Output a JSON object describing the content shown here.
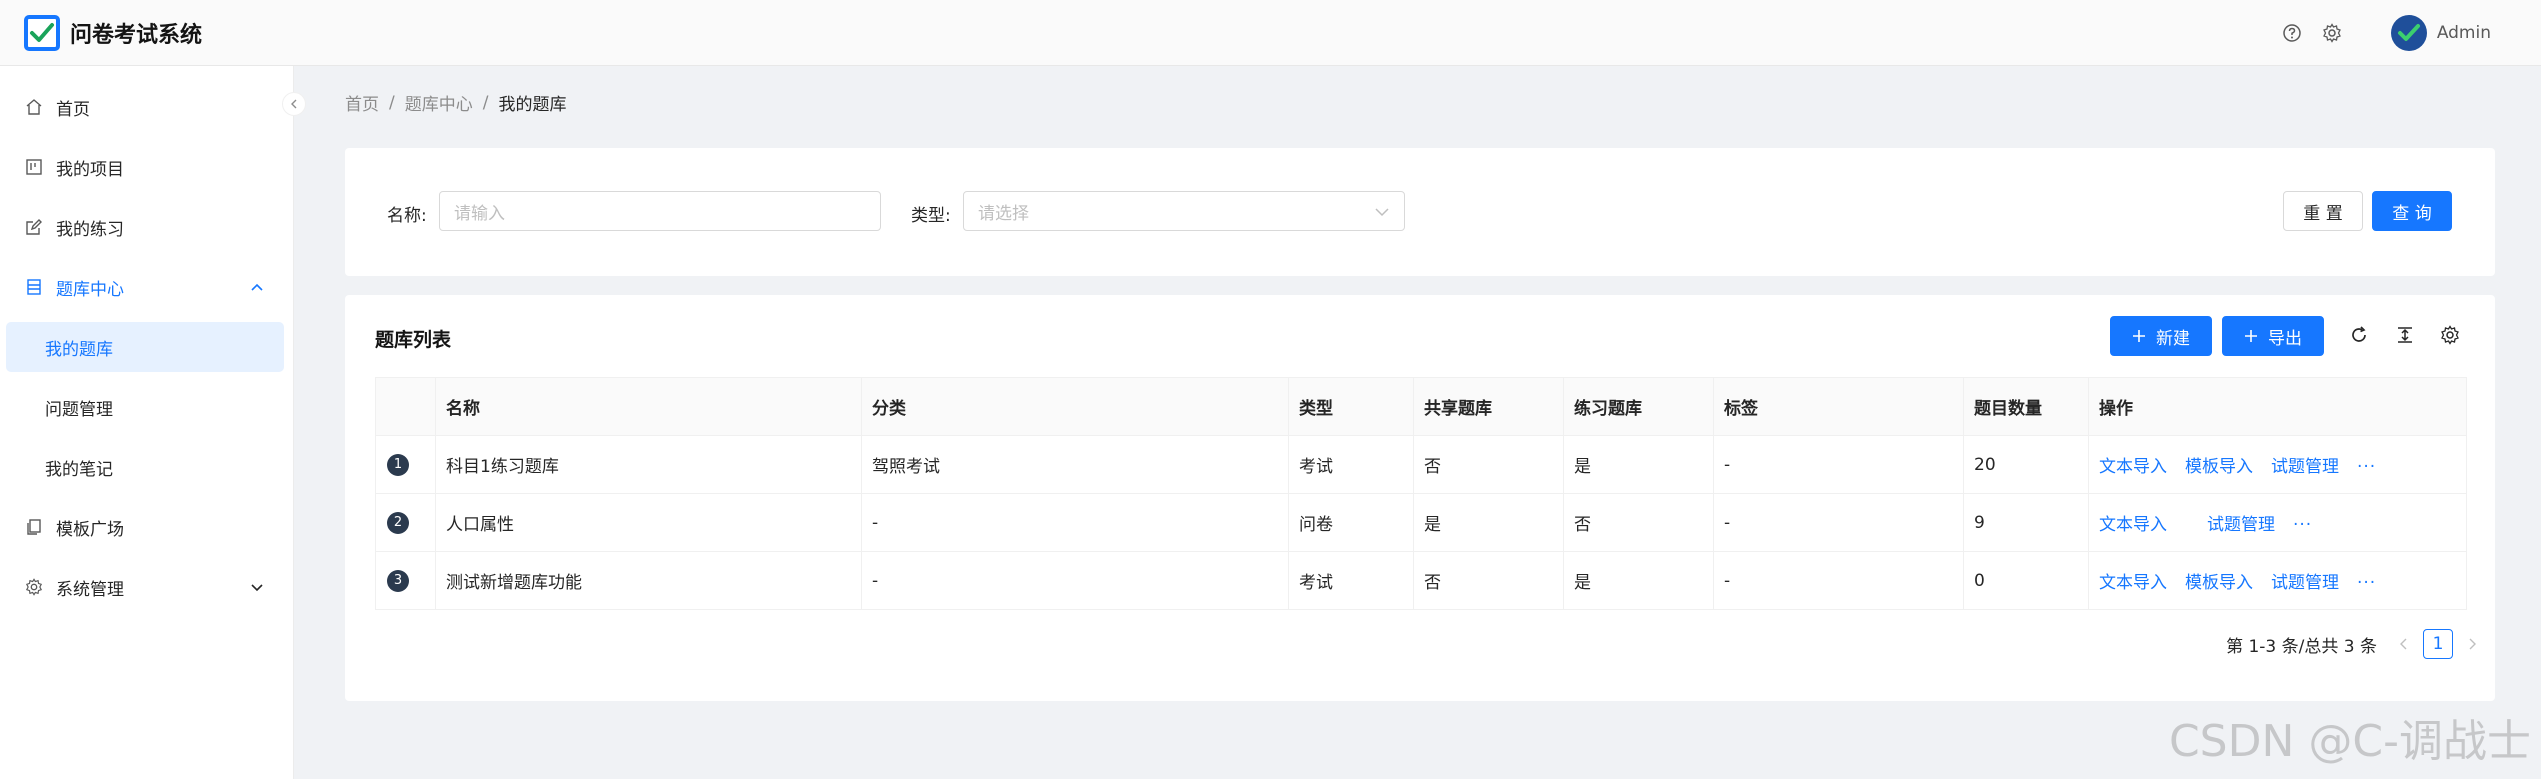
{
  "app": {
    "title": "问卷考试系统",
    "user": "Admin"
  },
  "sidebar": {
    "items": [
      {
        "label": "首页",
        "icon": "home-icon"
      },
      {
        "label": "我的项目",
        "icon": "project-icon"
      },
      {
        "label": "我的练习",
        "icon": "edit-icon"
      },
      {
        "label": "题库中心",
        "icon": "database-icon"
      },
      {
        "label": "模板广场",
        "icon": "copy-icon"
      },
      {
        "label": "系统管理",
        "icon": "gear-icon"
      }
    ],
    "sub_items": [
      "我的题库",
      "问题管理",
      "我的笔记"
    ]
  },
  "breadcrumb": {
    "items": [
      "首页",
      "题库中心",
      "我的题库"
    ],
    "separator": "/"
  },
  "search": {
    "name_label": "名称:",
    "name_placeholder": "请输入",
    "type_label": "类型:",
    "type_placeholder": "请选择",
    "reset_label": "重 置",
    "query_label": "查 询"
  },
  "table": {
    "title": "题库列表",
    "new_label": "新建",
    "export_label": "导出",
    "columns": [
      "",
      "名称",
      "分类",
      "类型",
      "共享题库",
      "练习题库",
      "标签",
      "题目数量",
      "操作"
    ],
    "rows": [
      {
        "index": "1",
        "name": "科目1练习题库",
        "category": "驾照考试",
        "type": "考试",
        "shared": "否",
        "practice": "是",
        "tag": "-",
        "count": "20",
        "ops": [
          "文本导入",
          "模板导入",
          "试题管理"
        ],
        "more": "···"
      },
      {
        "index": "2",
        "name": "人口属性",
        "category": "-",
        "type": "问卷",
        "shared": "是",
        "practice": "否",
        "tag": "-",
        "count": "9",
        "ops": [
          "文本导入",
          "试题管理"
        ],
        "more": "···"
      },
      {
        "index": "3",
        "name": "测试新增题库功能",
        "category": "-",
        "type": "考试",
        "shared": "否",
        "practice": "是",
        "tag": "-",
        "count": "0",
        "ops": [
          "文本导入",
          "模板导入",
          "试题管理"
        ],
        "more": "···"
      }
    ]
  },
  "pagination": {
    "summary": "第 1-3 条/总共 3 条",
    "current": "1"
  },
  "watermark": "CSDN @C-调战士",
  "colors": {
    "primary": "#1677ff",
    "background": "#f0f2f5",
    "active_bg": "#e6f1ff"
  }
}
